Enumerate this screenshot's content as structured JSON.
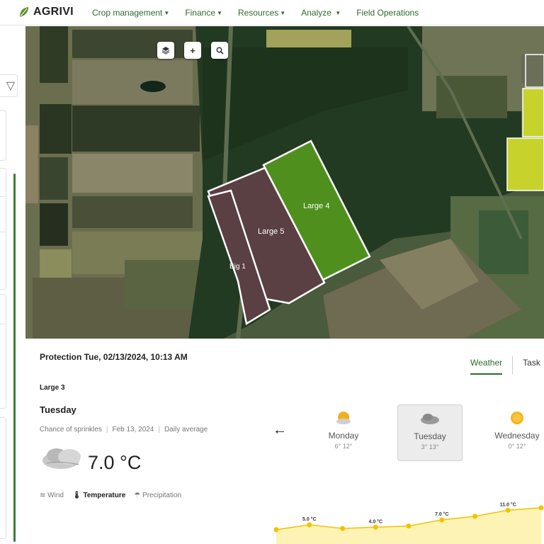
{
  "app": {
    "logo_text": "AGRIVI"
  },
  "nav": {
    "items": [
      {
        "label": "Crop management",
        "caret": true
      },
      {
        "label": "Finance",
        "caret": true
      },
      {
        "label": "Resources",
        "caret": true
      },
      {
        "label": "Analyze",
        "caret": true
      },
      {
        "label": "Field Operations",
        "caret": false
      }
    ]
  },
  "map": {
    "buttons": [
      "layers-icon",
      "plus-icon",
      "search-icon"
    ],
    "fields": [
      {
        "label": "Large 4",
        "color": "#4f8f1e"
      },
      {
        "label": "Large 5",
        "color": "#5a3f43"
      },
      {
        "label": "Big 1",
        "color": "#5a3f43"
      }
    ]
  },
  "panel": {
    "protection": "Protection Tue, 02/13/2024, 10:13 AM",
    "tabs": [
      "Weather",
      "Task"
    ],
    "field_name": "Large 3",
    "day": "Tuesday",
    "meta": [
      "Chance of sprinkles",
      "Feb 13, 2024",
      "Daily average"
    ],
    "temperature": "7.0 °C",
    "toggles": [
      {
        "label": "Wind",
        "icon": "wind-icon"
      },
      {
        "label": "Temperature",
        "icon": "thermometer-icon"
      },
      {
        "label": "Precipitation",
        "icon": "umbrella-icon"
      }
    ],
    "forecast": [
      {
        "day": "Monday",
        "range": "6° 12°",
        "icon": "partly-sunny-icon"
      },
      {
        "day": "Tuesday",
        "range": "3° 13°",
        "icon": "cloudy-icon"
      },
      {
        "day": "Wednesday",
        "range": "0° 12°",
        "icon": "sunny-icon"
      }
    ]
  },
  "chart_data": {
    "type": "area",
    "series": [
      {
        "name": "",
        "values": [
          3.0,
          5.0,
          3.5,
          4.0,
          4.5,
          7.0,
          8.5,
          11.0,
          12.0
        ]
      }
    ],
    "labels": [
      "",
      "5.0 °C",
      "",
      "4.0 °C",
      "",
      "7.0 °C",
      "",
      "11.0 °C",
      ""
    ],
    "ylim": [
      0,
      14
    ],
    "fill": "#fdf3b4",
    "line": "#f2c200"
  }
}
